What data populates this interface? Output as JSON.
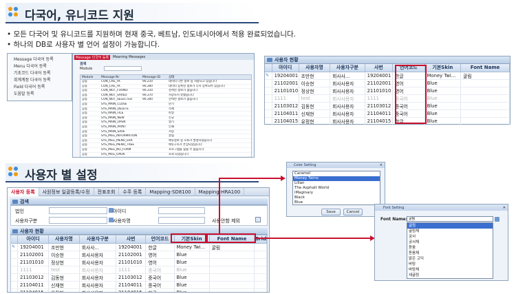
{
  "section1": {
    "title": "다국어, 유니코드 지원"
  },
  "bullets": [
    "• 모든 다국어 및 유니코드를 지원하며 현재 중국, 베트남, 인도네시아에서 적용 완료되었습니다.",
    "• 하나의 DB로 사용자 별 언어 설정이 가능합니다."
  ],
  "menu_window": {
    "items": [
      "Message 다국어 등록",
      "Menu 다국어 등록",
      "기초코드 다국어 등록",
      "회계계정 다국어 등록",
      "Field 다국어 등록",
      "도움말 등록"
    ],
    "tabs": [
      "Message 다국어 등록",
      "Meaning Messages"
    ],
    "search_label": "검색",
    "module_label": "Module",
    "columns": [
      "Module",
      "Message Nr",
      "Message ID",
      "상태"
    ],
    "rows": [
      [
        "공통",
        "CON_CRE_FK",
        "90,210",
        "데이터 다른 정보 중 사용되고 있습니다"
      ],
      [
        "공통",
        "CON_CRE_FK",
        "90,360",
        "데이터 등록된 정보가 다시 등록되어 있습니다"
      ],
      [
        "공통",
        "CON_NOT_FOUND",
        "90,310",
        "검색된 정보가 없습니다"
      ],
      [
        "공통",
        "CON_NOT_SAVED",
        "90,370",
        "저장하지 못했습니다"
      ],
      [
        "공통",
        "CON_NOT_SELECTED",
        "90,300",
        "선택된 정보가 없습니다"
      ],
      [
        "공통",
        "SYS_MAIN_CLOSE",
        "",
        "닫기"
      ],
      [
        "공통",
        "SYS_MAIN_DELETE",
        "",
        "삭제"
      ],
      [
        "공통",
        "SYS_MAIN_FILE",
        "",
        "파일"
      ],
      [
        "공통",
        "SYS_MAIN_NEW",
        "",
        "신규"
      ],
      [
        "공통",
        "SYS_MAIN_OPEN",
        "",
        "열기"
      ],
      [
        "공통",
        "SYS_MAIN_PRINT",
        "",
        "인쇄"
      ],
      [
        "공통",
        "SYS_MAIN_SAVE",
        "",
        "저장"
      ],
      [
        "공통",
        "SYS_MSG_INFORMATION",
        "",
        "알림"
      ],
      [
        "공통",
        "SYS_MSG_MENU_ERR",
        "",
        "메뉴정보 중 오류가 발생하였습니다"
      ],
      [
        "공통",
        "SYS_MSG_MENU_TREE",
        "",
        "메뉴구조가 손상되었습니다"
      ],
      [
        "공통",
        "SYS_MSG_NO_FORM",
        "",
        "프로그램을 찾을 수 없습니다"
      ],
      [
        "공통",
        "SYS_MSG_OPEN",
        "",
        "조회 되었습니다"
      ]
    ]
  },
  "user_grid_top": {
    "title": "사용자 현황",
    "columns": [
      "아이디",
      "사용자명",
      "사용자구분",
      "사번",
      "언어코드",
      "기본Skin",
      "Font Name"
    ],
    "rows": [
      {
        "marker": "✎",
        "cells": [
          "19204001",
          "조만현",
          "회사사...",
          "19204001",
          "한글",
          "Money Twi...",
          "굴림"
        ],
        "grey": false
      },
      {
        "marker": "",
        "cells": [
          "21102001",
          "이승현",
          "회사사용자",
          "21102001",
          "영어",
          "Blue",
          ""
        ],
        "grey": false
      },
      {
        "marker": "",
        "cells": [
          "21101010",
          "정상현",
          "회사사용자",
          "21101010",
          "영어",
          "Blue",
          ""
        ],
        "grey": false
      },
      {
        "marker": "",
        "cells": [
          "1111",
          "test",
          "회사사용자",
          "1111",
          "중국어",
          "Blue",
          ""
        ],
        "grey": true
      },
      {
        "marker": "",
        "cells": [
          "21103012",
          "김동현",
          "회사사용자",
          "21103012",
          "중국어",
          "Blue",
          ""
        ],
        "grey": false
      },
      {
        "marker": "",
        "cells": [
          "21104011",
          "신재현",
          "회사사용자",
          "21104011",
          "중국어",
          "Blue",
          ""
        ],
        "grey": false
      },
      {
        "marker": "",
        "cells": [
          "21104015",
          "유정현",
          "회사사용자",
          "21104015",
          "한글",
          "Blue",
          ""
        ],
        "grey": false
      }
    ]
  },
  "section2": {
    "title": "사용자 별 설정"
  },
  "main_tabs": [
    "사용자 등록",
    "사원정보 일괄등록/수정",
    "전표조회",
    "수주 등록",
    "Mapping-SD8100",
    "Mapping-HRA100"
  ],
  "search_panel": {
    "title": "검색",
    "corp_label": "법인",
    "id_label": "아이디",
    "user_type_label": "사용자구분",
    "user_name_label": "사용자명",
    "exclude_label": "사용안함 제외"
  },
  "user_grid_bottom": {
    "title": "사용자 현황",
    "columns": [
      "아이디",
      "사용자명",
      "사용자구분",
      "사번",
      "언어코드",
      "기본Skin",
      "Font Name",
      "Grid"
    ],
    "rows": [
      {
        "marker": "✎",
        "cells": [
          "19204001",
          "조만현",
          "회사사...",
          "19204001",
          "한글",
          "Money Twi...",
          "굴림"
        ],
        "grey": false
      },
      {
        "marker": "",
        "cells": [
          "21102001",
          "이승현",
          "회사사용자",
          "21102001",
          "영어",
          "Blue",
          ""
        ],
        "grey": false
      },
      {
        "marker": "",
        "cells": [
          "21101010",
          "정상현",
          "회사사용자",
          "21101010",
          "영어",
          "Blue",
          ""
        ],
        "grey": false
      },
      {
        "marker": "",
        "cells": [
          "1111",
          "test",
          "회사사용자",
          "1111",
          "중국어",
          "Blue",
          ""
        ],
        "grey": true
      },
      {
        "marker": "",
        "cells": [
          "21103012",
          "김동현",
          "회사사용자",
          "21103012",
          "중국어",
          "Blue",
          ""
        ],
        "grey": false
      },
      {
        "marker": "",
        "cells": [
          "21104011",
          "신재현",
          "회사사용자",
          "21104011",
          "중국어",
          "Blue",
          ""
        ],
        "grey": false
      },
      {
        "marker": "",
        "cells": [
          "21104015",
          "유정현",
          "회사사용자",
          "21104015",
          "한글",
          "Blue",
          ""
        ],
        "grey": false
      }
    ]
  },
  "color_dialog": {
    "title": "Color Setting",
    "options": [
      "Caramel",
      "Money Twins",
      "Lilian",
      "The Asphalt World",
      "iMaginary",
      "Black",
      "Blue"
    ],
    "selected": "Money Twins",
    "save_label": "Save",
    "cancel_label": "Cancel"
  },
  "font_dialog": {
    "title": "Font Setting",
    "font_name_label": "Font Name:",
    "value": "굴림",
    "options": [
      "굴림",
      "굴림체",
      "궁서",
      "궁서체",
      "돋움",
      "돋움체",
      "맑은 고딕",
      "바탕",
      "바탕체",
      "새굴림"
    ],
    "selected": "굴림"
  },
  "colors": {
    "accent": "#c8102e",
    "header": "#1b3358",
    "title_bar": "#2b4a7a"
  }
}
